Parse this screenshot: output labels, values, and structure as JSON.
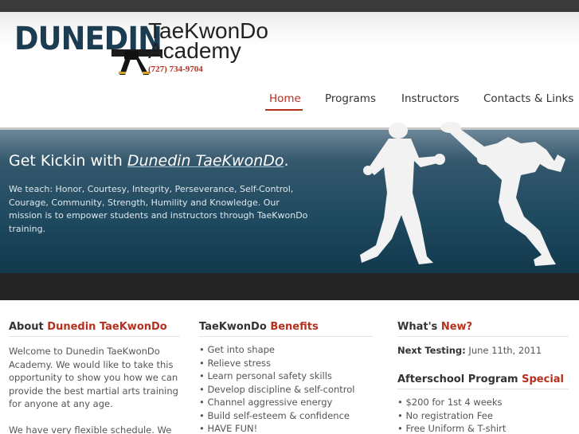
{
  "logo": {
    "name": "DUNEDIN",
    "line1": "TaeKwonDo",
    "line2": "Academy",
    "phone": "(727) 734-9704"
  },
  "nav": {
    "items": [
      {
        "label": "Home",
        "active": true
      },
      {
        "label": "Programs",
        "active": false
      },
      {
        "label": "Instructors",
        "active": false
      },
      {
        "label": "Contacts & Links",
        "active": false
      }
    ]
  },
  "hero": {
    "title_prefix": "Get Kickin with ",
    "title_em": "Dunedin TaeKwonDo",
    "title_suffix": ".",
    "text": "We teach: Honor, Courtesy, Integrity, Perseverance, Self-Control, Courage, Community, Strength, Humility and Knowledge. Our mission is to empower students and instructors through TaeKwonDo training."
  },
  "about": {
    "heading_plain": "About ",
    "heading_accent": "Dunedin TaeKwonDo",
    "para1": "Welcome to Dunedin TaeKwonDo Academy. We would like to take this opportunity to show you how we can provide the best martial arts training for anyone at any age.",
    "para2": "We have very flexible schedule. We also"
  },
  "benefits": {
    "heading_plain": "TaeKwonDo ",
    "heading_accent": "Benefits",
    "items": [
      "Get into shape",
      "Relieve stress",
      "Learn personal safety skills",
      "Develop discipline & self-control",
      "Channel aggressive energy",
      "Build self-esteem & confidence",
      "HAVE FUN!"
    ]
  },
  "whatsnew": {
    "heading_plain": "What's ",
    "heading_accent": "New?",
    "next_label": "Next Testing:",
    "next_value": " June 11th, 2011",
    "afterschool_plain": "Afterschool Program ",
    "afterschool_accent": "Special",
    "items": [
      "$200 for 1st 4 weeks",
      "No registration Fee",
      "Free Uniform & T-shirt"
    ]
  },
  "colors": {
    "accent": "#b5301e",
    "logo_blue": "#1c3c52",
    "hero_dark": "#12384c"
  }
}
